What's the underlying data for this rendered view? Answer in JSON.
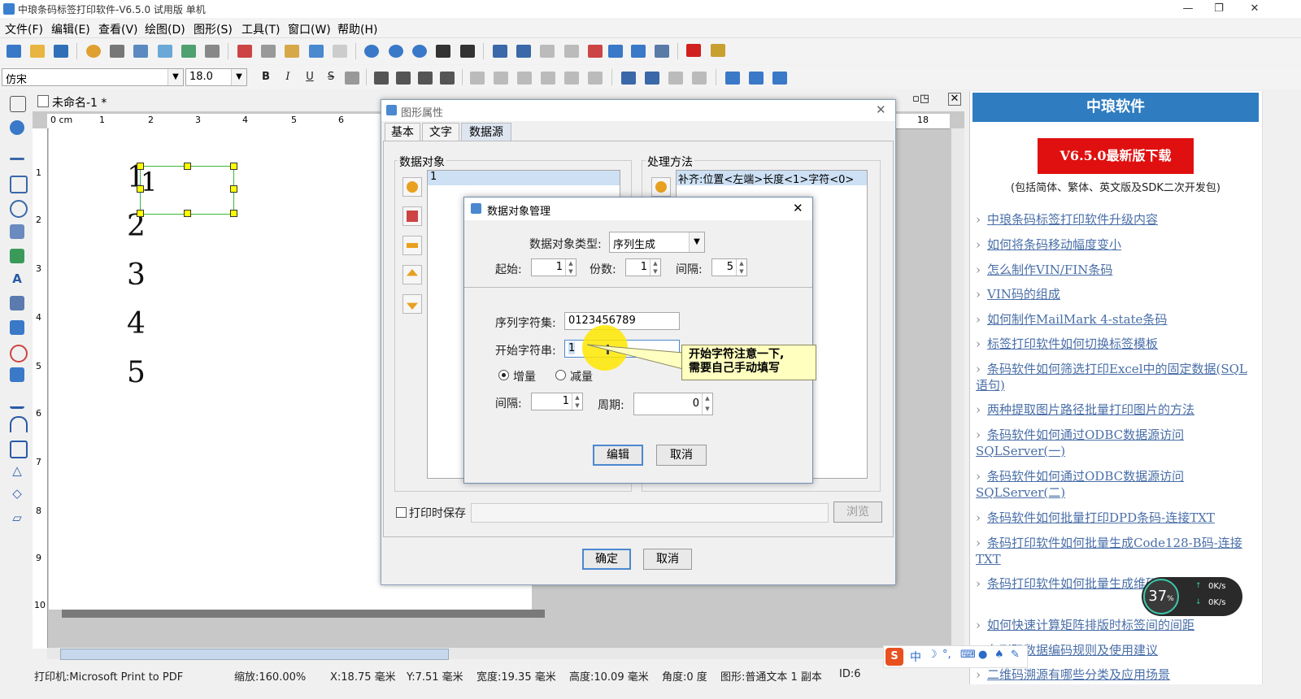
{
  "app": {
    "title": "中琅条码标签打印软件-V6.5.0 试用版 单机"
  },
  "menu": [
    "文件(F)",
    "编辑(E)",
    "查看(V)",
    "绘图(D)",
    "图形(S)",
    "工具(T)",
    "窗口(W)",
    "帮助(H)"
  ],
  "format_toolbar": {
    "font": "仿宋",
    "font_size": "18.0",
    "bold": "B",
    "italic": "I",
    "underline": "U",
    "strike": "S"
  },
  "document": {
    "tab_title": "未命名-1 *",
    "ruler_unit": "0 cm",
    "ruler_marks": [
      "1",
      "2",
      "3",
      "4",
      "5",
      "6",
      "18"
    ],
    "vruler_marks": [
      "1",
      "2",
      "3",
      "4",
      "5",
      "6",
      "7",
      "8",
      "9",
      "10"
    ],
    "canvas_numbers": [
      "1",
      "2",
      "3",
      "4",
      "5"
    ],
    "selected_text": "1"
  },
  "dialog_props": {
    "title": "图形属性",
    "tabs": [
      "基本",
      "文字",
      "数据源"
    ],
    "active_tab": "数据源",
    "data_object_label": "数据对象",
    "data_object_item": "1",
    "process_label": "处理方法",
    "process_item": "补齐:位置<左端>长度<1>字符<0>",
    "save_on_print": "打印时保存",
    "browse": "浏览",
    "ok": "确定",
    "cancel": "取消"
  },
  "dialog_dom": {
    "title": "数据对象管理",
    "type_label": "数据对象类型:",
    "type_value": "序列生成",
    "start_label": "起始:",
    "start_value": "1",
    "copies_label": "份数:",
    "copies_value": "1",
    "interval_label": "间隔:",
    "interval_value": "5",
    "charset_label": "序列字符集:",
    "charset_value": "0123456789",
    "start_str_label": "开始字符串:",
    "start_str_value": "1",
    "increase": "增量",
    "decrease": "减量",
    "step_label": "间隔:",
    "step_value": "1",
    "period_label": "周期:",
    "period_value": "0",
    "edit": "编辑",
    "cancel": "取消"
  },
  "callout": {
    "line1": "开始字符注意一下,",
    "line2": "需要自己手动填写"
  },
  "status": {
    "printer": "打印机:Microsoft Print to PDF",
    "zoom": "缩放:160.00%",
    "x": "X:18.75 毫米",
    "y": "Y:7.51 毫米",
    "width": "宽度:19.35 毫米",
    "height": "高度:10.09 毫米",
    "angle": "角度:0 度",
    "shape": "图形:普通文本 1 副本",
    "id": "ID:6"
  },
  "right_panel": {
    "header": "中琅软件",
    "download": "V6.5.0最新版下载",
    "desc": "(包括简体、繁体、英文版及SDK二次开发包)",
    "links": [
      "中琅条码标签打印软件升级内容",
      "如何将条码移动幅度变小",
      "怎么制作VIN/FIN条码",
      "VIN码的组成",
      "如何制作MailMark 4-state条码",
      "标签打印软件如何切换标签模板",
      "条码软件如何筛选打印Excel中的固定数据(SQL语句)",
      "两种提取图片路径批量打印图片的方法",
      "条码软件如何通过ODBC数据源访问SQLServer(一)",
      "条码软件如何通过ODBC数据源访问SQLServer(二)",
      "条码软件如何批量打印DPD条码-连接TXT",
      "条码打印软件如何批量生成Code128-B码-连接TXT",
      "条码打印软件如何批量生成维码",
      "如何快速计算矩阵排版时标签间的间距",
      "条形码数据编码规则及使用建议",
      "二维码溯源有哪些分类及应用场景"
    ]
  },
  "speed_widget": {
    "percent": "37",
    "unit": "%",
    "up": "0K/s",
    "down": "0K/s"
  },
  "ime": "中"
}
